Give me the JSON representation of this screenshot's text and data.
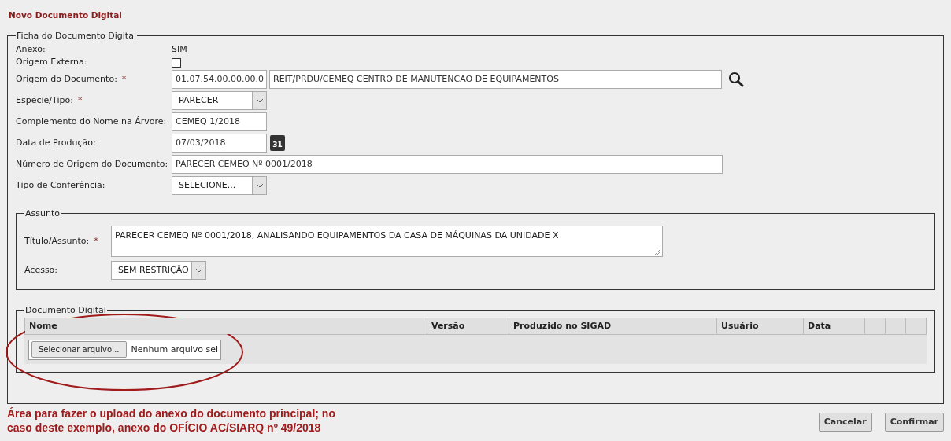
{
  "title": "Novo Documento Digital",
  "record": {
    "legend": "Ficha do Documento Digital",
    "fields": [
      {
        "kind": "text",
        "label": "Anexo:",
        "value": "SIM"
      },
      {
        "kind": "checkbox",
        "label": "Origem Externa:",
        "checked": false
      },
      {
        "kind": "lookup",
        "label": "Origem do Documento:",
        "required_mark": "*",
        "code": "01.07.54.00.00.00.0",
        "value": "REIT/PRDU/CEMEQ CENTRO DE MANUTENCAO DE EQUIPAMENTOS"
      },
      {
        "kind": "select",
        "label": "Espécie/Tipo:",
        "required_mark": "*",
        "value": "PARECER"
      },
      {
        "kind": "input",
        "label": "Complemento do Nome na Árvore:",
        "value": "CEMEQ 1/2018"
      },
      {
        "kind": "date",
        "label": "Data de Produção:",
        "value": "07/03/2018",
        "icon_text": "31"
      },
      {
        "kind": "wide",
        "label": "Número de Origem do Documento:",
        "value": "PARECER CEMEQ Nº 0001/2018"
      },
      {
        "kind": "select",
        "label": "Tipo de Conferência:",
        "value": "SELECIONE..."
      }
    ]
  },
  "subject": {
    "legend": "Assunto",
    "fields": [
      {
        "kind": "textarea",
        "label": "Título/Assunto:",
        "required_mark": "*",
        "value": "PARECER CEMEQ Nº 0001/2018, ANALISANDO EQUIPAMENTOS DA CASA DE MÁQUINAS DA UNIDADE X"
      },
      {
        "kind": "select",
        "label": "Acesso:",
        "value": "SEM RESTRIÇÃO"
      }
    ]
  },
  "digital_document": {
    "legend": "Documento Digital",
    "table": {
      "columns": [
        "Nome",
        "Versão",
        "Produzido no SIGAD",
        "Usuário",
        "Data",
        "",
        "",
        ""
      ]
    },
    "file_input": {
      "button": "Selecionar arquivo...",
      "status": "Nenhum arquivo sel"
    }
  },
  "note": "Área para fazer o upload do anexo do documento principal; no caso deste exemplo, anexo do OFÍCIO AC/SIARQ nº 49/2018",
  "buttons": [
    "Cancelar",
    "Confirmar"
  ]
}
